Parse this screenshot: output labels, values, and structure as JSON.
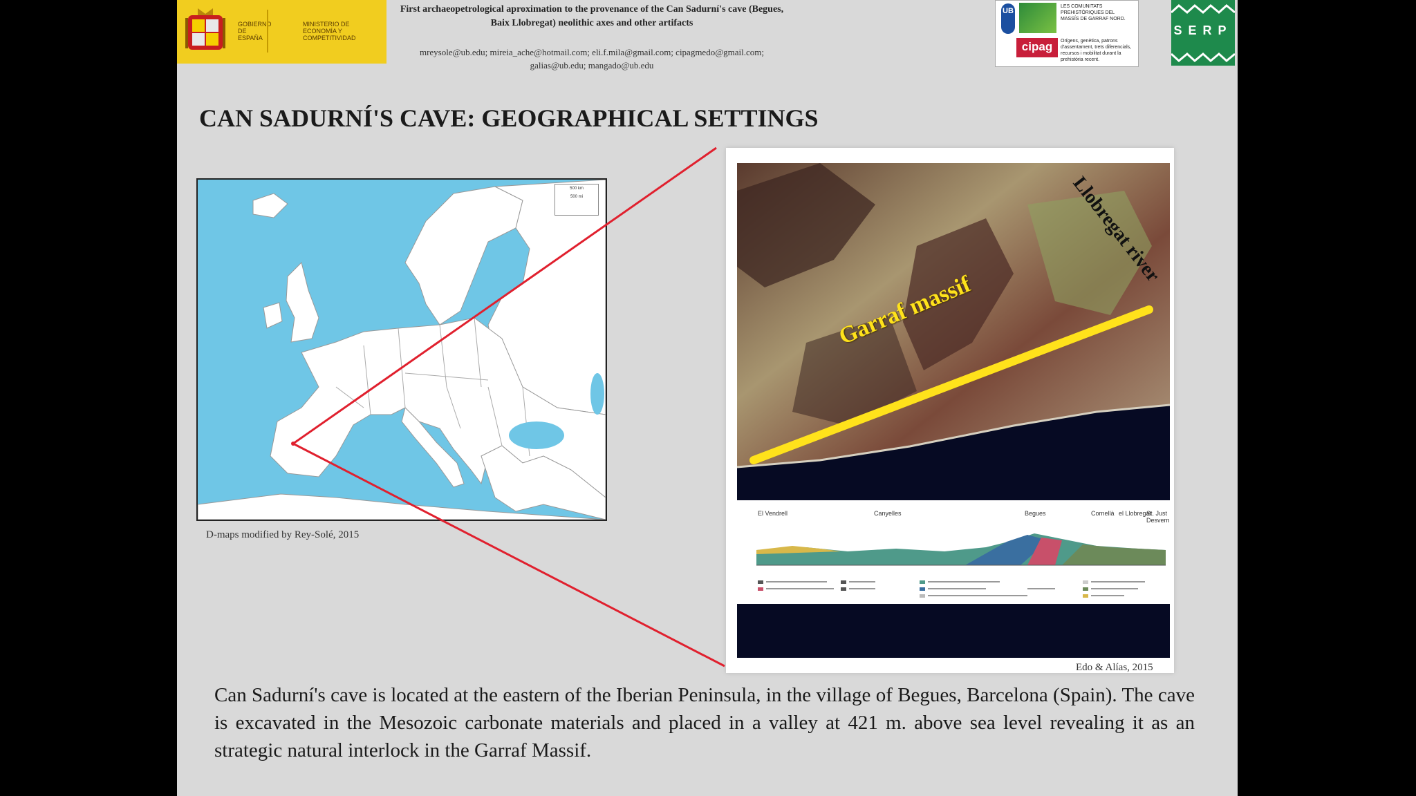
{
  "header": {
    "gov_logo": {
      "line1": "GOBIERNO DE ESPAÑA",
      "line2": "MINISTERIO DE ECONOMÍA Y COMPETITIVIDAD"
    },
    "title": "First archaeopetrological aproximation to the provenance of the Can Sadurní's cave (Begues, Baix Llobregat) neolithic axes and other artifacts",
    "emails": "mreysole@ub.edu; mireia_ache@hotmail.com; eli.f.mila@gmail.com; cipagmedo@gmail.com; galias@ub.edu; mangado@ub.edu",
    "cipag_logo": {
      "ub": "UB",
      "name": "cipag",
      "caption1": "LES COMUNITATS PREHISTÒRIQUES DEL MASSÍS DE GARRAF NORD.",
      "caption2": "Orígens, genètica, patrons d'assentament, trets diferencials, recursos i mobilitat durant la prehistòria recent."
    },
    "serp_logo": "SERP"
  },
  "slide": {
    "title": "CAN SADURNÍ'S CAVE: GEOGRAPHICAL SETTINGS",
    "map_credit": "D-maps modified by Rey-Solé, 2015",
    "map_scale": [
      "500 km",
      "500 mi"
    ],
    "satellite_labels": {
      "garraf": "Garraf massif",
      "llobregat": "Llobregat river"
    },
    "profile_locations": [
      "El Vendrell",
      "Canyelles",
      "Begues",
      "Cornellà",
      "el Llobregat",
      "St. Just Desvern"
    ],
    "satellite_credit": "Edo & Alías, 2015",
    "body": "Can Sadurní's cave is located at the eastern of the Iberian Peninsula, in the village of Begues, Barcelona (Spain). The cave is excavated in the Mesozoic carbonate materials and placed in a valley at 421 m. above sea level revealing it as an strategic natural interlock in the Garraf Massif."
  },
  "colors": {
    "slide_bg": "#d9d9d9",
    "sea": "#6fc6e6",
    "land": "#ffffff",
    "zoom_lines": "#e0202e",
    "garraf_line": "#ffe21b",
    "gov_yellow": "#f1cd1f",
    "serp_green": "#1e8a4c"
  }
}
